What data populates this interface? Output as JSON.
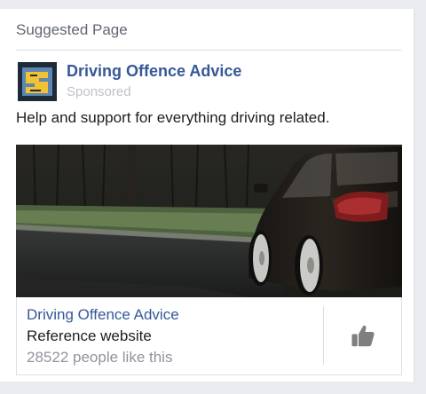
{
  "header": {
    "title": "Suggested Page"
  },
  "post": {
    "page_name": "Driving Offence Advice",
    "sponsored_label": "Sponsored",
    "description": "Help and support for everything driving related."
  },
  "link": {
    "title": "Driving Offence Advice",
    "category": "Reference website",
    "likes": "28522 people like this"
  },
  "icons": {
    "avatar": "road-sign-logo",
    "like": "thumbs-up-icon"
  },
  "colors": {
    "link_blue": "#365899",
    "muted_text": "#90949c",
    "sponsored_text": "#bec2c9",
    "avatar_yellow": "#f2c232"
  }
}
